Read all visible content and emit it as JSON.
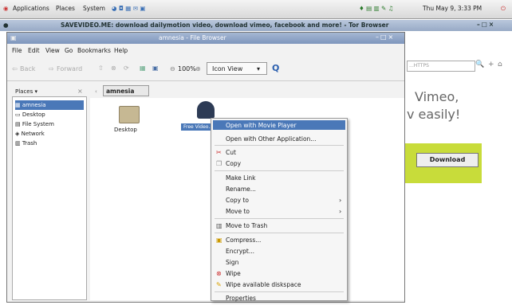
{
  "panel": {
    "applications": "Applications",
    "places": "Places",
    "system": "System",
    "clock": "Thu May 9, 3:33 PM"
  },
  "tor": {
    "title": "SAVEVIDEO.ME: download dailymotion video, download vimeo, facebook and more! - Tor Browser"
  },
  "browser": {
    "search_placeholder": "...HTTPS",
    "vimeo": "Vimeo,",
    "easily": "v easily!",
    "download": "Download"
  },
  "filebrowser": {
    "title": "amnesia - File Browser",
    "menus": [
      "File",
      "Edit",
      "View",
      "Go",
      "Bookmarks",
      "Help"
    ],
    "toolbar": {
      "back": "Back",
      "forward": "Forward",
      "zoom": "100%",
      "view": "Icon View"
    },
    "places_label": "Places",
    "places": [
      "amnesia",
      "Desktop",
      "File System",
      "Network",
      "Trash"
    ],
    "path": "amnesia",
    "desktop_label": "Desktop",
    "file_label": "Free Video..."
  },
  "context_menu": {
    "items": [
      {
        "label": "Open with Movie Player"
      },
      {
        "label": "Open with Other Application..."
      },
      {
        "label": "Cut"
      },
      {
        "label": "Copy"
      },
      {
        "label": "Make Link"
      },
      {
        "label": "Rename..."
      },
      {
        "label": "Copy to"
      },
      {
        "label": "Move to"
      },
      {
        "label": "Move to Trash"
      },
      {
        "label": "Compress..."
      },
      {
        "label": "Encrypt..."
      },
      {
        "label": "Sign"
      },
      {
        "label": "Wipe"
      },
      {
        "label": "Wipe available diskspace"
      },
      {
        "label": "Properties"
      }
    ]
  }
}
